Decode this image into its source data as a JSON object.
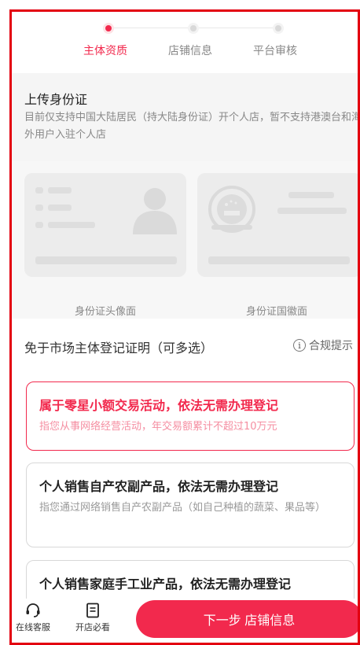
{
  "steps": [
    {
      "label": "主体资质",
      "active": true
    },
    {
      "label": "店铺信息",
      "active": false
    },
    {
      "label": "平台审核",
      "active": false
    }
  ],
  "upload": {
    "title": "上传身份证",
    "description": "目前仅支持中国大陆居民（持大陆身份证）开个人店，暂不支持港澳台和海外用户入驻个人店",
    "front_caption": "身份证头像面",
    "back_caption": "身份证国徽面"
  },
  "exempt": {
    "title": "免于市场主体登记证明（可多选）",
    "compliance_label": "合规提示"
  },
  "options": [
    {
      "title": "属于零星小额交易活动，依法无需办理登记",
      "desc": "指您从事网络经营活动，年交易额累计不超过10万元",
      "selected": true
    },
    {
      "title": "个人销售自产农副产品，依法无需办理登记",
      "desc": "指您通过网络销售自产农副产品（如自己种植的蔬菜、果品等）",
      "selected": false
    },
    {
      "title": "个人销售家庭手工业产品，依法无需办理登记",
      "desc": "",
      "selected": false
    }
  ],
  "bottom": {
    "service_label": "在线客服",
    "guide_label": "开店必看",
    "next_label": "下一步 店铺信息"
  },
  "colors": {
    "accent": "#f2294d",
    "frame": "#e3000f"
  },
  "icons": {
    "service": "headset-icon",
    "guide": "document-icon",
    "info": "info-icon",
    "portrait": "person-silhouette-icon",
    "emblem": "national-emblem-icon"
  }
}
